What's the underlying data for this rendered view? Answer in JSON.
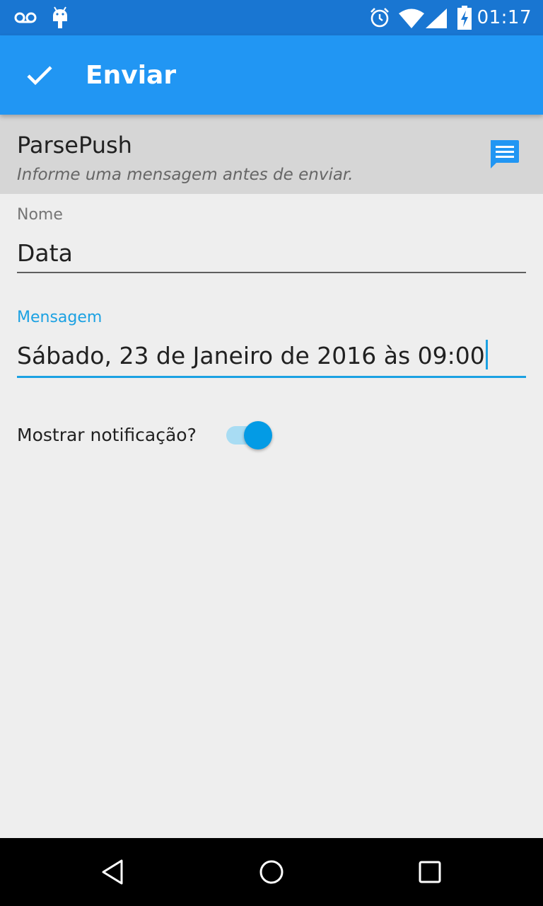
{
  "status_bar": {
    "time": "01:17",
    "icons": [
      "voicemail-icon",
      "android-icon",
      "alarm-icon",
      "wifi-icon",
      "signal-icon",
      "battery-charging-icon"
    ]
  },
  "app_bar": {
    "action_icon": "check-icon",
    "title": "Enviar",
    "color": "#2196f3"
  },
  "header": {
    "title": "ParsePush",
    "subtitle": "Informe uma mensagem antes de enviar.",
    "icon": "message-icon"
  },
  "form": {
    "name_label": "Nome",
    "name_value": "Data",
    "message_label": "Mensagem",
    "message_value": "Sábado, 23 de Janeiro de 2016 às 09:00",
    "notification_label": "Mostrar notificação?",
    "notification_on": true,
    "accent_color": "#1ba1e2"
  },
  "nav_bar": {
    "icons": [
      "back-icon",
      "home-icon",
      "recents-icon"
    ]
  }
}
